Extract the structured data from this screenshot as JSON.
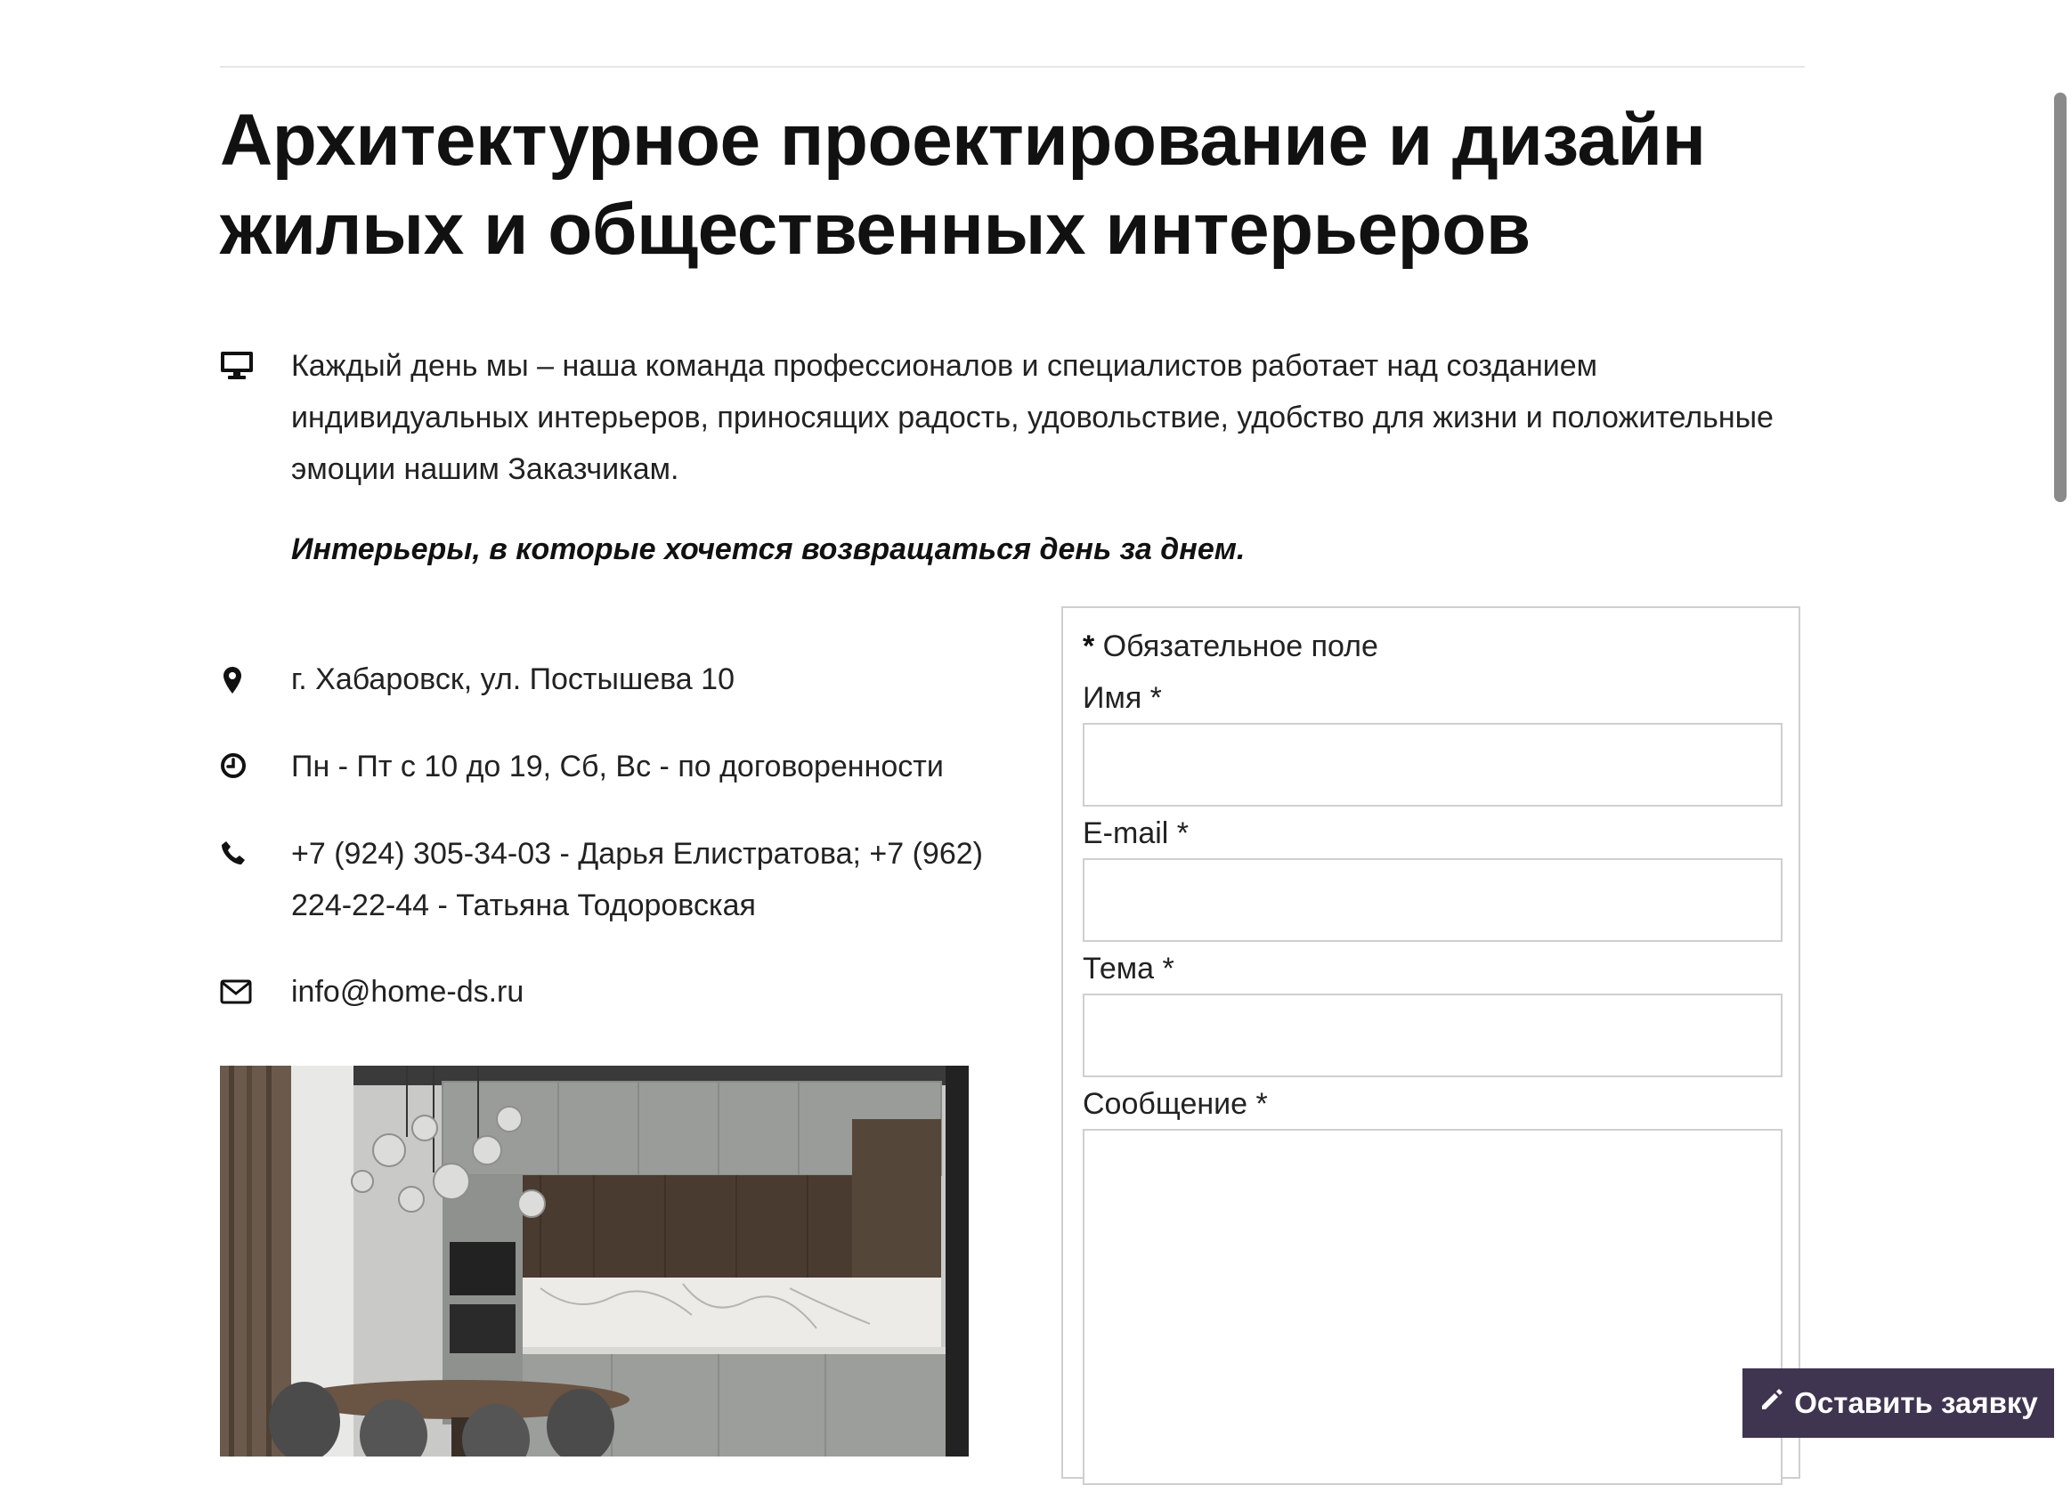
{
  "page": {
    "title": "Архитектурное проектирование и дизайн жилых и общественных интерьеров",
    "intro": "Каждый день мы – наша команда профессионалов и специалистов работает над созданием индивидуальных интерьеров, приносящих радость, удовольствие, удобство для жизни и положительные эмоции нашим Заказчикам.",
    "slogan": "Интерьеры, в которые хочется возвращаться день за днем."
  },
  "icons": {
    "intro": "desktop-icon",
    "address": "map-marker-icon",
    "hours": "clock-icon",
    "phone": "phone-icon",
    "email": "envelope-icon",
    "cta": "pencil-icon"
  },
  "contacts": {
    "address": "г. Хабаровск, ул. Постышева 10",
    "hours": "Пн - Пт с 10 до 19, Сб, Вс - по договоренности",
    "phone": "+7 (924) 305-34-03 - Дарья Елистратова; +7 (962) 224-22-44 - Татьяна Тодоровская",
    "email": "info@home-ds.ru"
  },
  "form": {
    "required_star": "*",
    "required_note": " Обязательное поле",
    "name_label": "Имя *",
    "name_value": "",
    "email_label": "E-mail *",
    "email_value": "",
    "subject_label": "Тема *",
    "subject_value": "",
    "message_label": "Сообщение *",
    "message_value": ""
  },
  "cta": {
    "label": "Оставить заявку"
  },
  "colors": {
    "cta_background": "#3f3550",
    "text": "#1a1a1a",
    "border": "#cfcfcf"
  }
}
